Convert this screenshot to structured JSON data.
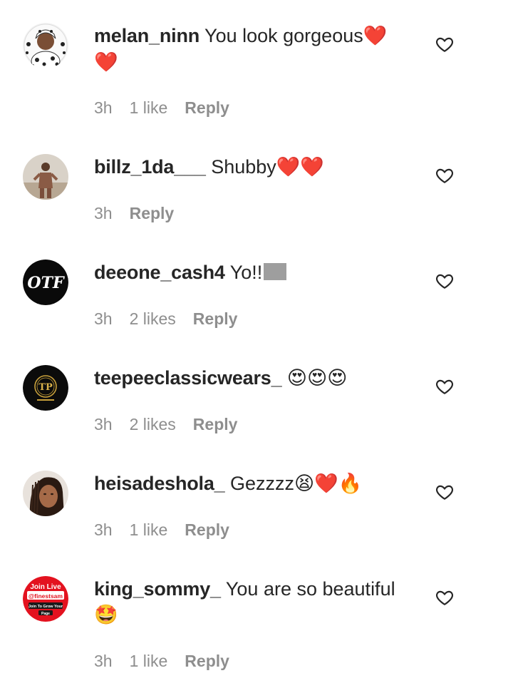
{
  "comments": [
    {
      "username": "melan_ninn",
      "text": "You look gorgeous",
      "emoji_after": "❤️❤️",
      "time": "3h",
      "likes": "1 like",
      "reply": "Reply",
      "avatar": "dalmatian-outfit-avatar"
    },
    {
      "username": "billz_1da___",
      "text": "Shubby",
      "emoji_after": "❤️❤️",
      "time": "3h",
      "likes": "",
      "reply": "Reply",
      "avatar": "person-photo-avatar"
    },
    {
      "username": "deeone_cash4",
      "text": "Yo!!",
      "emoji_after": "",
      "time": "3h",
      "likes": "2 likes",
      "reply": "Reply",
      "avatar": "otf-logo-avatar"
    },
    {
      "username": "teepeeclassicwears_",
      "text": "",
      "emoji_after": "😍😍😍",
      "time": "3h",
      "likes": "2 likes",
      "reply": "Reply",
      "avatar": "tp-gold-logo-avatar"
    },
    {
      "username": "heisadeshola_",
      "text": "Gezzzz",
      "emoji_after": "😫❤️🔥",
      "time": "3h",
      "likes": "1 like",
      "reply": "Reply",
      "avatar": "person-photo-avatar"
    },
    {
      "username": "king_sommy_",
      "text": "You are so beautiful",
      "emoji_after": "🤩",
      "time": "3h",
      "likes": "1 like",
      "reply": "Reply",
      "avatar": "join-live-promo-avatar",
      "avatar_text": [
        "Join Live",
        "@finestsam",
        "Join To Grow Your",
        "Page"
      ]
    }
  ],
  "colors": {
    "username": "#262626",
    "meta": "#8e8e8e",
    "heart": "#ed1c2e"
  }
}
